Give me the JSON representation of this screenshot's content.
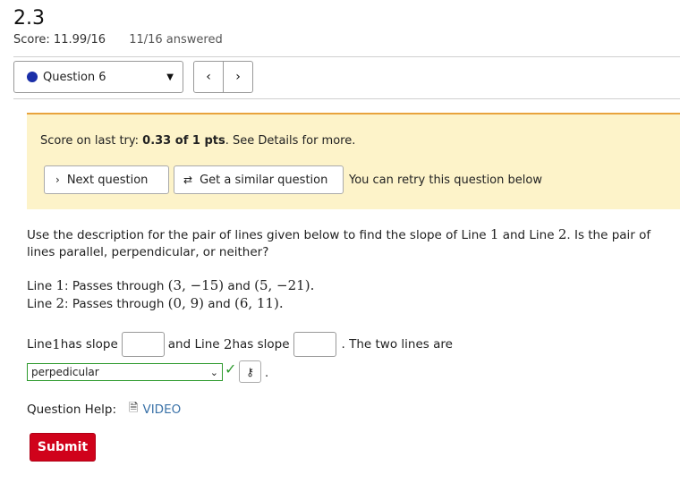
{
  "header": {
    "title": "2.3",
    "score": "Score: 11.99/16",
    "answered": "11/16 answered"
  },
  "question_nav": {
    "selected": "Question 6",
    "prev_icon": "‹",
    "next_icon": "›"
  },
  "feedback": {
    "prefix": "Score on last try: ",
    "score_bold": "0.33 of 1 pts",
    "suffix": ". See Details for more.",
    "next_question": "Next question",
    "similar_question": "Get a similar question",
    "retry": "You can retry this question below"
  },
  "question": {
    "prompt_a": "Use the description for the pair of lines given below to find the slope of Line ",
    "one": "1",
    "prompt_b": " and Line ",
    "two": "2",
    "prompt_c": ". Is the pair of lines parallel, perpendicular, or neither?",
    "line1_label": "Line ",
    "line1_num": "1",
    "line1_mid": ": Passes through ",
    "line1_p1": "(3, −15)",
    "line1_and": " and ",
    "line1_p2": "(5, −21)",
    "line1_end": ".",
    "line2_label": "Line ",
    "line2_num": "2",
    "line2_mid": ": Passes through ",
    "line2_p1": "(0, 9)",
    "line2_and": " and ",
    "line2_p2": "(6, 11)",
    "line2_end": "."
  },
  "answer": {
    "a1": "Line ",
    "a1num": "1",
    "a1b": " has slope",
    "a2": "and Line ",
    "a2num": "2",
    "a2b": " has slope",
    "a3": ". The two lines are",
    "slope1_value": "",
    "slope2_value": "",
    "lines_selected": "perpedicular",
    "period": "."
  },
  "help": {
    "label": "Question Help:",
    "video": "VIDEO"
  },
  "submit": "Submit",
  "colors": {
    "submit": "#d0021b",
    "feedback_bg": "#fdf3c9",
    "feedback_border": "#e8a33d",
    "correct": "#2e9a2e",
    "link": "#3a72a8",
    "question_dot": "#1a2ea8"
  },
  "icons": {
    "chevron_right": "›",
    "similar": "⇄",
    "check": "✓",
    "key": "⚷",
    "doc": "🗎"
  }
}
